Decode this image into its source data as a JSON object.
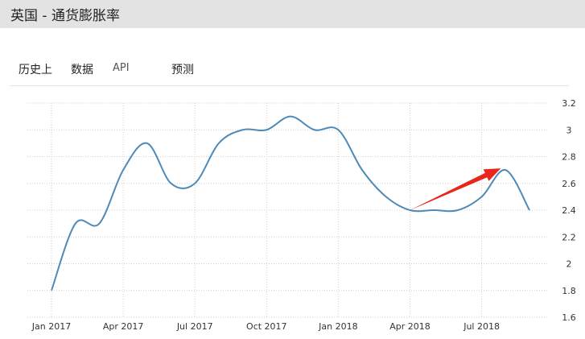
{
  "header": {
    "title": "英国 - 通货膨胀率"
  },
  "tabs": [
    {
      "label": "历史上"
    },
    {
      "label": "数据"
    },
    {
      "label": "API"
    },
    {
      "label": "预测"
    }
  ],
  "colors": {
    "header_bg": "#e3e3e3",
    "line": "#4e8ab8",
    "annotation_arrow": "#e8261b",
    "grid": "#cfcfcf"
  },
  "chart_data": {
    "type": "line",
    "title": "",
    "xlabel": "",
    "ylabel": "",
    "ylim": [
      1.6,
      3.2
    ],
    "yticks": [
      "3.2",
      "3",
      "2.8",
      "2.6",
      "2.4",
      "2.2",
      "2",
      "1.8",
      "1.6"
    ],
    "y_axis_position": "right",
    "grid": "dotted",
    "xticks": [
      "Jan 2017",
      "Apr 2017",
      "Jul 2017",
      "Oct 2017",
      "Jan 2018",
      "Apr 2018",
      "Jul 2018"
    ],
    "series": [
      {
        "x": [
          "2017-01",
          "2017-02",
          "2017-03",
          "2017-04",
          "2017-05",
          "2017-06",
          "2017-07",
          "2017-08",
          "2017-09",
          "2017-10",
          "2017-11",
          "2017-12",
          "2018-01",
          "2018-02",
          "2018-03",
          "2018-04",
          "2018-05",
          "2018-06",
          "2018-07",
          "2018-08",
          "2018-09"
        ],
        "values": [
          1.8,
          2.3,
          2.3,
          2.7,
          2.9,
          2.6,
          2.6,
          2.9,
          3.0,
          3.0,
          3.1,
          3.0,
          3.0,
          2.7,
          2.5,
          2.4,
          2.4,
          2.4,
          2.5,
          2.7,
          2.4
        ]
      }
    ],
    "annotation": {
      "type": "arrow",
      "from": {
        "x": "2018-04",
        "y": 2.4
      },
      "to": {
        "x": "2018-08",
        "y": 2.7
      }
    }
  }
}
